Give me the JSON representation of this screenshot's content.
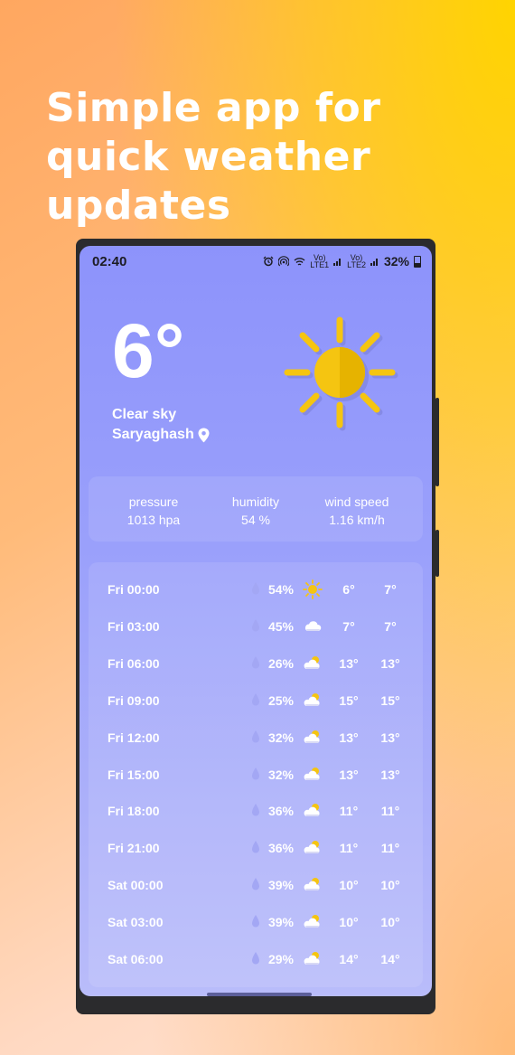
{
  "headline": "Simple app for quick weather updates",
  "status_bar": {
    "time": "02:40",
    "battery": "32%",
    "net1": "LTE1",
    "net2": "LTE2",
    "volte": "Vo)",
    "wifi_label": "6"
  },
  "current": {
    "temperature": "6°",
    "condition": "Clear sky",
    "location": "Saryaghash"
  },
  "details": [
    {
      "label": "pressure",
      "value": "1013 hpa"
    },
    {
      "label": "humidity",
      "value": "54 %"
    },
    {
      "label": "wind speed",
      "value": "1.16 km/h"
    }
  ],
  "forecast": [
    {
      "time": "Fri 00:00",
      "humidity": "54%",
      "icon": "sun-icon",
      "min": "6°",
      "max": "7°"
    },
    {
      "time": "Fri 03:00",
      "humidity": "45%",
      "icon": "cloud-icon",
      "min": "7°",
      "max": "7°"
    },
    {
      "time": "Fri 06:00",
      "humidity": "26%",
      "icon": "partly-cloudy-icon",
      "min": "13°",
      "max": "13°"
    },
    {
      "time": "Fri 09:00",
      "humidity": "25%",
      "icon": "partly-cloudy-icon",
      "min": "15°",
      "max": "15°"
    },
    {
      "time": "Fri 12:00",
      "humidity": "32%",
      "icon": "partly-cloudy-icon",
      "min": "13°",
      "max": "13°"
    },
    {
      "time": "Fri 15:00",
      "humidity": "32%",
      "icon": "partly-cloudy-icon",
      "min": "13°",
      "max": "13°"
    },
    {
      "time": "Fri 18:00",
      "humidity": "36%",
      "icon": "partly-cloudy-icon",
      "min": "11°",
      "max": "11°"
    },
    {
      "time": "Fri 21:00",
      "humidity": "36%",
      "icon": "partly-cloudy-icon",
      "min": "11°",
      "max": "11°"
    },
    {
      "time": "Sat 00:00",
      "humidity": "39%",
      "icon": "partly-cloudy-icon",
      "min": "10°",
      "max": "10°"
    },
    {
      "time": "Sat 03:00",
      "humidity": "39%",
      "icon": "partly-cloudy-icon",
      "min": "10°",
      "max": "10°"
    },
    {
      "time": "Sat 06:00",
      "humidity": "29%",
      "icon": "partly-cloudy-icon",
      "min": "14°",
      "max": "14°"
    }
  ],
  "colors": {
    "sun": "#f5c511",
    "sun_shade": "#e0a800",
    "screen_top": "#8d93fb",
    "screen_bottom": "#b9bcfa"
  }
}
